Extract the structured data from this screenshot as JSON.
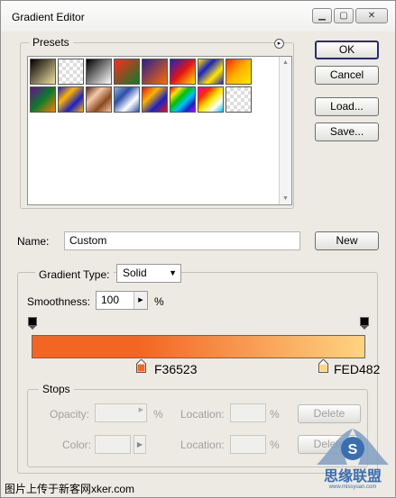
{
  "window": {
    "title": "Gradient Editor"
  },
  "buttons": {
    "ok": "OK",
    "cancel": "Cancel",
    "load": "Load...",
    "save": "Save...",
    "new": "New",
    "delete": "Delete"
  },
  "presets": {
    "label": "Presets",
    "swatches": [
      "linear-gradient(135deg,#000 0%,#f3e0a0 100%)",
      "repeating-conic-gradient(#ddd 0 25%,#fff 0 50%) 0 0/8px 8px",
      "linear-gradient(135deg,#000,#fff)",
      "linear-gradient(135deg,#ff2a1b,#0b7b2a)",
      "linear-gradient(135deg,#2a1f8f,#ff6a00)",
      "linear-gradient(135deg,#1a22c4,#e31313,#ffe600)",
      "linear-gradient(135deg,#ffe600,#1a22c4,#ffe600,#1a22c4)",
      "linear-gradient(135deg,#ff2a00,#ffb400,#ffe600)",
      "linear-gradient(135deg,#6a0f8f,#0b7b2a,#ff7a00)",
      "linear-gradient(135deg,#1a22c4,#ffb400,#1a22c4,#ffb400)",
      "linear-gradient(135deg,#5a2a10,#f7c8a8,#8a4a20,#f7c8a8)",
      "linear-gradient(135deg,#8fb0d8,#2a4fa8,#fff,#2a4fa8)",
      "linear-gradient(135deg,#e31313,#ffb400,#1a22c4,#e31313)",
      "linear-gradient(135deg,#ff0000,#ffe600,#00c000,#00c0ff,#1a22c4,#c000ff)",
      "linear-gradient(135deg,#ff00aa,#ff2a00,#ffe600,#fff,#00c0ff)",
      "repeating-conic-gradient(#ddd 0 25%,#fff 0 50%) 0 0/8px 8px"
    ]
  },
  "name_field": {
    "label": "Name:",
    "value": "Custom"
  },
  "gradient_type": {
    "label": "Gradient Type:",
    "value": "Solid"
  },
  "smoothness": {
    "label": "Smoothness:",
    "value": "100",
    "unit": "%"
  },
  "gradient": {
    "start_color": "#F36523",
    "end_color": "#FED482",
    "start_label": "F36523",
    "end_label": "FED482"
  },
  "stops": {
    "label": "Stops",
    "opacity_label": "Opacity:",
    "color_label": "Color:",
    "location_label_1": "Location:",
    "location_label_2": "Location:",
    "percent_1": "%",
    "percent_2": "%",
    "percent_3": "%"
  },
  "footer": {
    "watermark_text": "图片上传于新客网xker.com",
    "logo_text": "思缘联盟",
    "logo_url": "www.missyuan.com"
  }
}
